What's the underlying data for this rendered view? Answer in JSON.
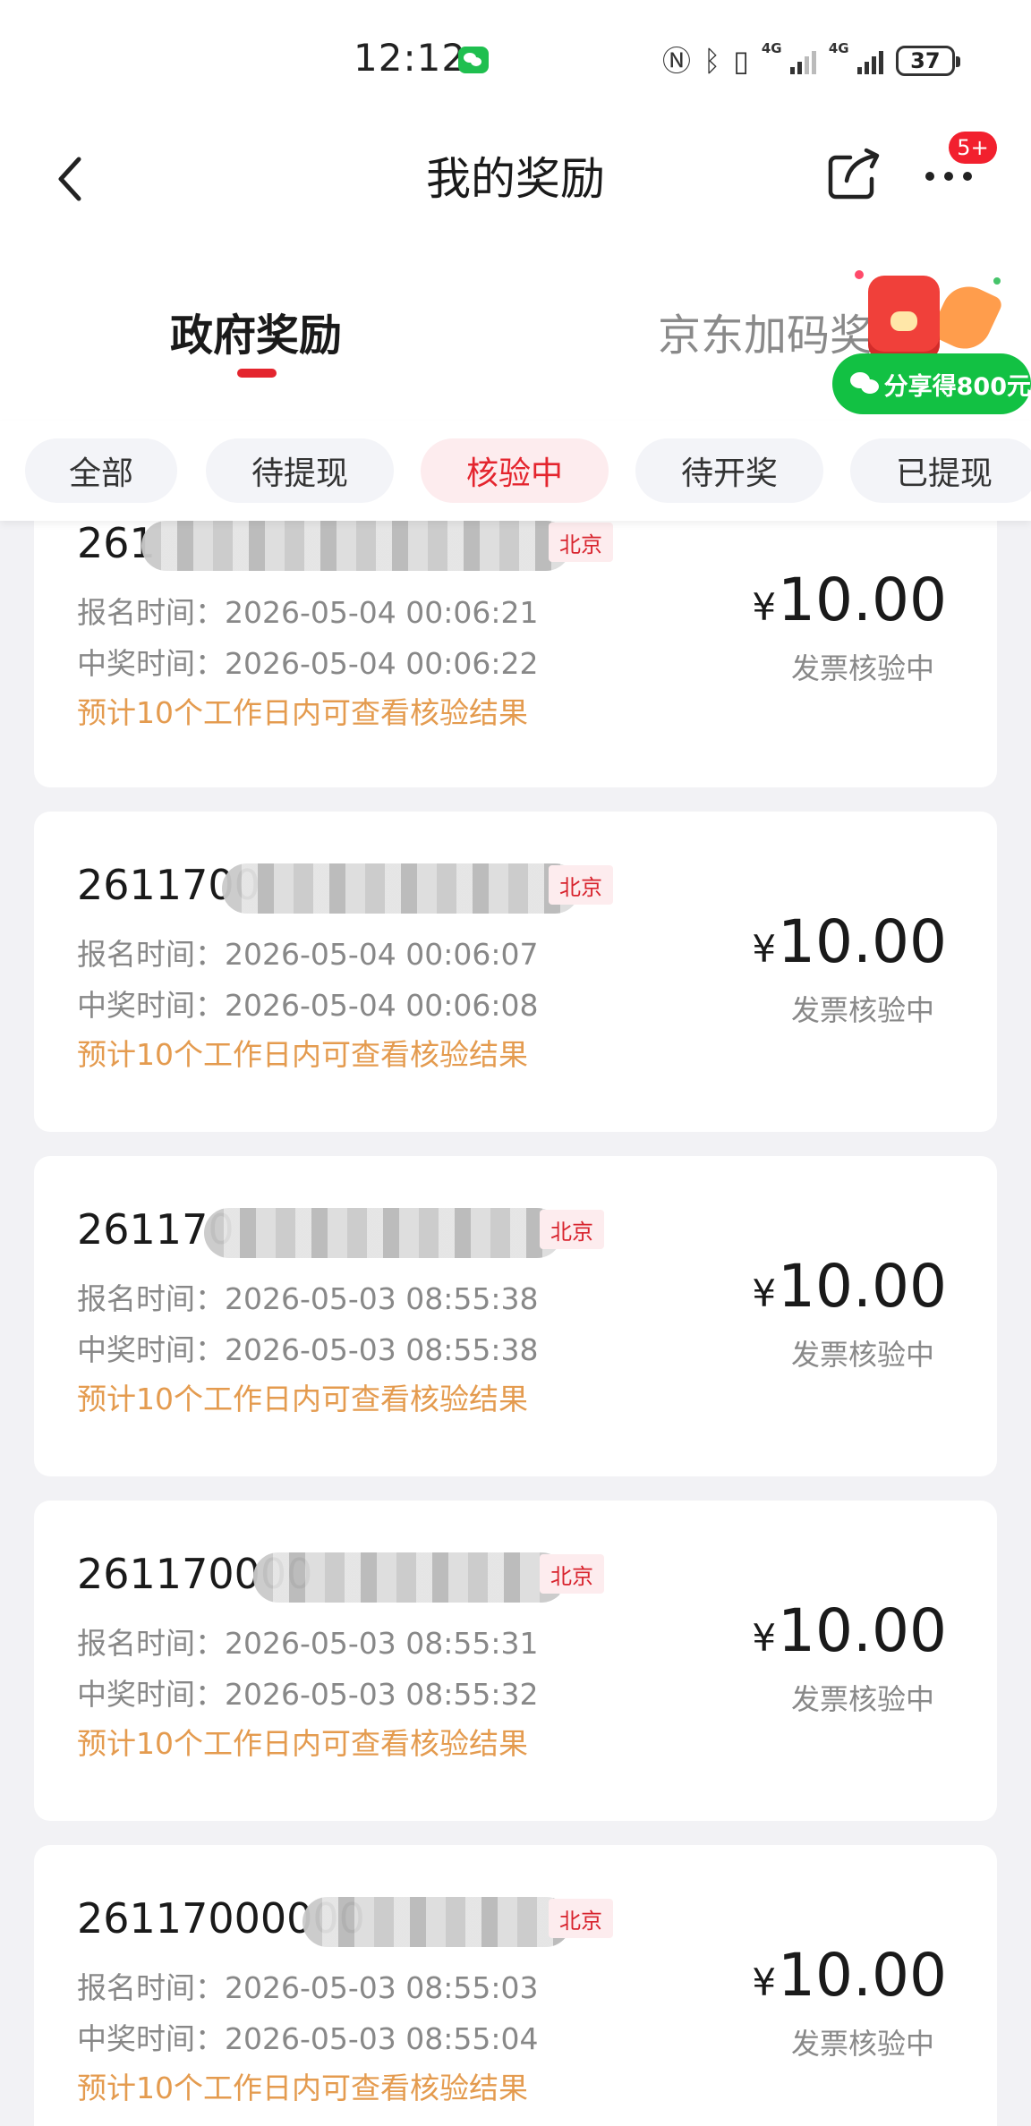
{
  "status_bar": {
    "time": "12:12",
    "network_label": "4G",
    "battery": "37"
  },
  "header": {
    "title": "我的奖励",
    "notification_badge": "5+"
  },
  "main_tabs": [
    {
      "label": "政府奖励",
      "active": true
    },
    {
      "label": "京东加码奖励",
      "active": false
    }
  ],
  "promo": {
    "label": "分享得800元"
  },
  "filters": [
    {
      "label": "全部",
      "active": false
    },
    {
      "label": "待提现",
      "active": false
    },
    {
      "label": "核验中",
      "active": true
    },
    {
      "label": "待开奖",
      "active": false
    },
    {
      "label": "已提现",
      "active": false
    }
  ],
  "cards": [
    {
      "id_visible": "261",
      "city": "北京",
      "signup": "报名时间：2026-05-04 00:06:21",
      "win": "中奖时间：2026-05-04 00:06:22",
      "note": "预计10个工作日内可查看核验结果",
      "currency": "¥",
      "amount": "10.00",
      "status": "发票核验中"
    },
    {
      "id_visible": "2611700",
      "city": "北京",
      "signup": "报名时间：2026-05-04 00:06:07",
      "win": "中奖时间：2026-05-04 00:06:08",
      "note": "预计10个工作日内可查看核验结果",
      "currency": "¥",
      "amount": "10.00",
      "status": "发票核验中"
    },
    {
      "id_visible": "261170",
      "city": "北京",
      "signup": "报名时间：2026-05-03 08:55:38",
      "win": "中奖时间：2026-05-03 08:55:38",
      "note": "预计10个工作日内可查看核验结果",
      "currency": "¥",
      "amount": "10.00",
      "status": "发票核验中"
    },
    {
      "id_visible": "261170000",
      "city": "北京",
      "signup": "报名时间：2026-05-03 08:55:31",
      "win": "中奖时间：2026-05-03 08:55:32",
      "note": "预计10个工作日内可查看核验结果",
      "currency": "¥",
      "amount": "10.00",
      "status": "发票核验中"
    },
    {
      "id_visible": "26117000000",
      "city": "北京",
      "signup": "报名时间：2026-05-03 08:55:03",
      "win": "中奖时间：2026-05-03 08:55:04",
      "note": "预计10个工作日内可查看核验结果",
      "currency": "¥",
      "amount": "10.00",
      "status": "发票核验中"
    }
  ],
  "colors": {
    "accent": "#e4252e",
    "note": "#e49b4f",
    "promo_green": "#12c143",
    "page_bg": "#f2f2f5"
  }
}
